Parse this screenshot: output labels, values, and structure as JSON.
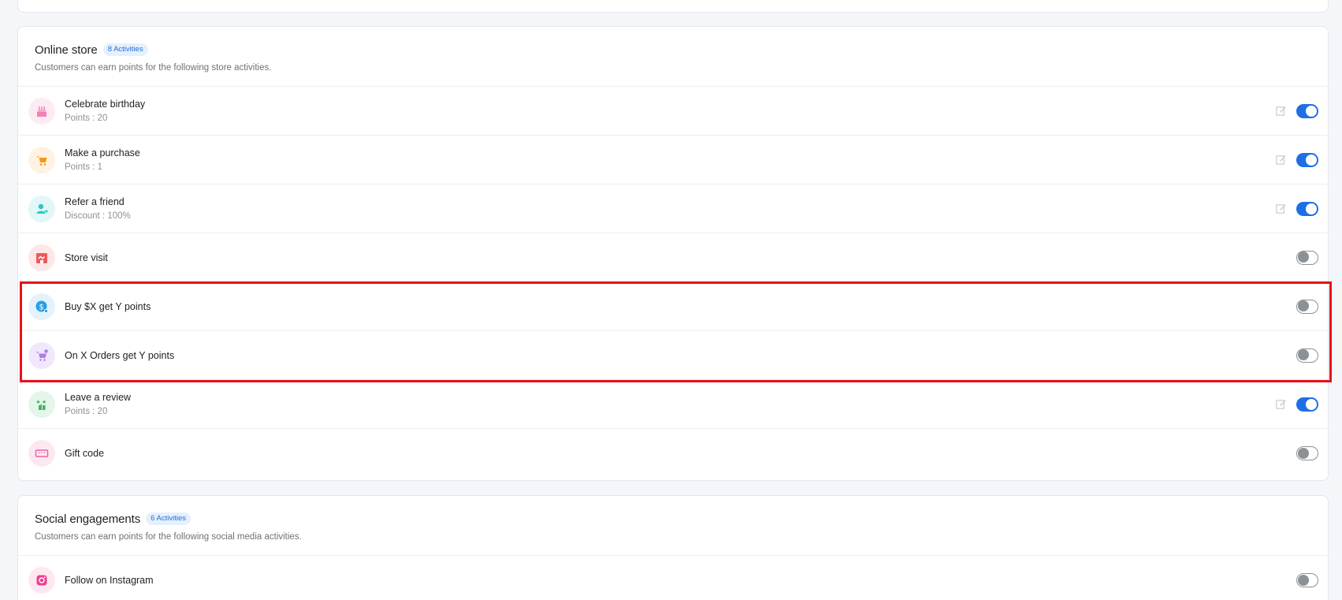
{
  "online_store": {
    "title": "Online store",
    "badge": "8 Activities",
    "subtitle": "Customers can earn points for the following store activities.",
    "items": [
      {
        "title": "Celebrate birthday",
        "sub": "Points : 20",
        "icon": "birthday-cake-icon",
        "enabled": true,
        "editable": true
      },
      {
        "title": "Make a purchase",
        "sub": "Points : 1",
        "icon": "shopping-cart-icon",
        "enabled": true,
        "editable": true
      },
      {
        "title": "Refer a friend",
        "sub": "Discount : 100%",
        "icon": "refer-user-icon",
        "enabled": true,
        "editable": true
      },
      {
        "title": "Store visit",
        "sub": "",
        "icon": "store-icon",
        "enabled": false,
        "editable": false
      },
      {
        "title": "Buy $X get Y points",
        "sub": "",
        "icon": "dollar-coin-icon",
        "enabled": false,
        "editable": false
      },
      {
        "title": "On X Orders get Y points",
        "sub": "",
        "icon": "cart-plus-icon",
        "enabled": false,
        "editable": false
      },
      {
        "title": "Leave a review",
        "sub": "Points : 20",
        "icon": "review-stars-icon",
        "enabled": true,
        "editable": true
      },
      {
        "title": "Gift code",
        "sub": "",
        "icon": "gift-code-icon",
        "enabled": false,
        "editable": false
      }
    ]
  },
  "social": {
    "title": "Social engagements",
    "badge": "6 Activities",
    "subtitle": "Customers can earn points for the following social media activities.",
    "items": [
      {
        "title": "Follow on Instagram",
        "sub": "",
        "icon": "instagram-icon",
        "enabled": false,
        "editable": false
      }
    ]
  },
  "colors": {
    "accent": "#1d6fe6",
    "highlight": "#e8101a"
  }
}
